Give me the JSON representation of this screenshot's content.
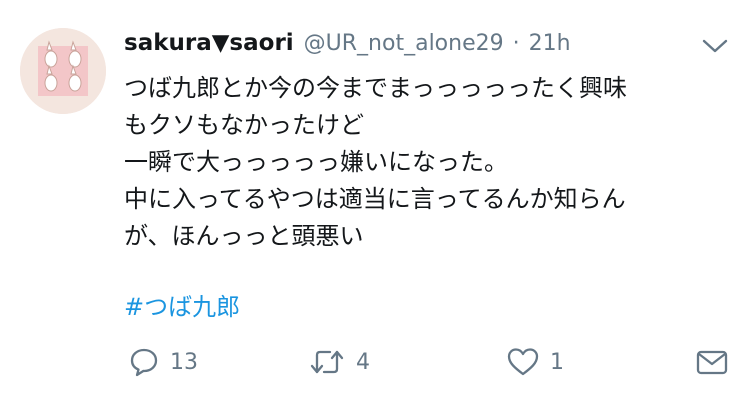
{
  "tweet": {
    "display_name": "sakura▼saori",
    "handle": "@UR_not_alone29",
    "separator": "·",
    "time": "21h",
    "text_lines": [
      "つば九郎とか今の今までまっっっっったく興味",
      "もクソもなかったけど",
      "一瞬で大っっっっっ嫌いになった。",
      "中に入ってるやつは適当に言ってるんか知らん",
      "が、ほんっっと頭悪い"
    ],
    "hashtag": "#つば九郎",
    "counts": {
      "replies": "13",
      "retweets": "4",
      "likes": "1"
    }
  },
  "icons": {
    "caret": "chevron-down-icon",
    "reply": "reply-bubble-icon",
    "retweet": "retweet-icon",
    "like": "heart-icon",
    "share": "envelope-icon"
  },
  "colors": {
    "text": "#14171a",
    "secondary": "#657786",
    "link": "#1b95e0",
    "avatar_bg": "#f4e6df"
  }
}
